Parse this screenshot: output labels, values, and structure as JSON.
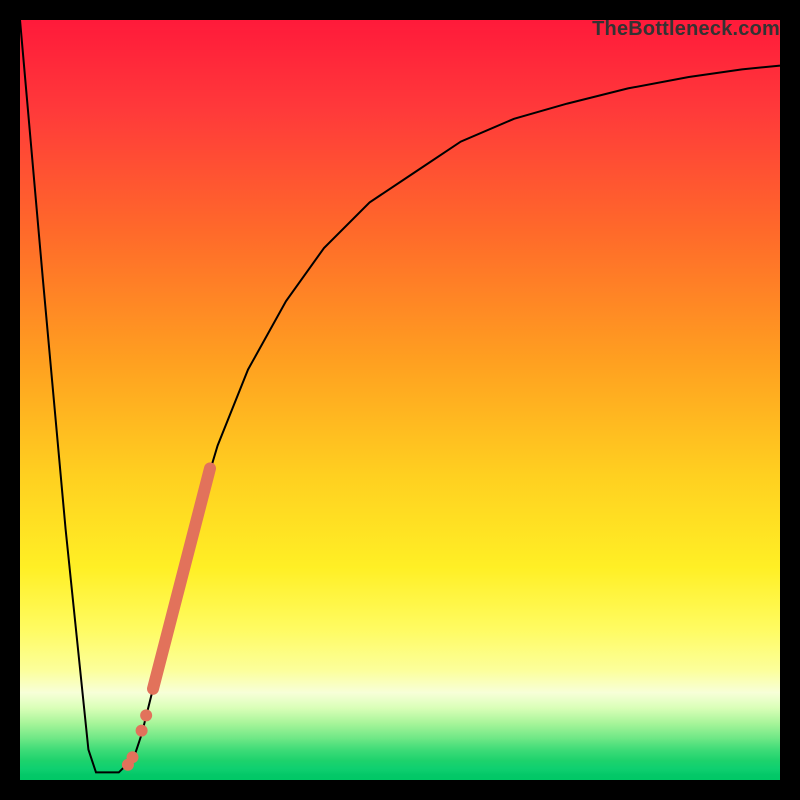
{
  "watermark": "TheBottleneck.com",
  "chart_data": {
    "type": "line",
    "title": "",
    "xlabel": "",
    "ylabel": "",
    "xlim": [
      0,
      100
    ],
    "ylim": [
      0,
      100
    ],
    "gradient": {
      "stops": [
        {
          "pct": 0,
          "color": "#ff1a3a"
        },
        {
          "pct": 12,
          "color": "#ff3a3a"
        },
        {
          "pct": 28,
          "color": "#ff6a2a"
        },
        {
          "pct": 45,
          "color": "#ffa020"
        },
        {
          "pct": 60,
          "color": "#ffd020"
        },
        {
          "pct": 72,
          "color": "#ffef25"
        },
        {
          "pct": 80,
          "color": "#fffb60"
        },
        {
          "pct": 85.5,
          "color": "#fcff9a"
        },
        {
          "pct": 88.5,
          "color": "#f7ffd8"
        },
        {
          "pct": 90.5,
          "color": "#daffb8"
        },
        {
          "pct": 92.5,
          "color": "#a8f59a"
        },
        {
          "pct": 94.5,
          "color": "#6fe886"
        },
        {
          "pct": 96,
          "color": "#3fdc78"
        },
        {
          "pct": 97.5,
          "color": "#1cd26c"
        },
        {
          "pct": 98.5,
          "color": "#0fd070"
        },
        {
          "pct": 99.3,
          "color": "#04c868"
        },
        {
          "pct": 100,
          "color": "#00c866"
        }
      ]
    },
    "series": [
      {
        "name": "bottleneck-curve",
        "x": [
          0,
          3,
          6,
          9,
          10,
          11,
          12,
          13,
          14,
          15,
          16,
          18,
          20,
          23,
          26,
          30,
          35,
          40,
          46,
          52,
          58,
          65,
          72,
          80,
          88,
          95,
          100
        ],
        "y": [
          100,
          66,
          33,
          4,
          1,
          1,
          1,
          1,
          2,
          3,
          6,
          14,
          23,
          34,
          44,
          54,
          63,
          70,
          76,
          80,
          84,
          87,
          89,
          91,
          92.5,
          93.5,
          94
        ]
      },
      {
        "name": "highlight-segment",
        "x": [
          17.5,
          25.0
        ],
        "y": [
          12.0,
          41.0
        ]
      }
    ],
    "points": [
      {
        "name": "pt1",
        "x": 14.2,
        "y": 2.0
      },
      {
        "name": "pt2",
        "x": 14.8,
        "y": 3.0
      },
      {
        "name": "pt3",
        "x": 16.0,
        "y": 6.5
      },
      {
        "name": "pt4",
        "x": 16.6,
        "y": 8.5
      }
    ]
  }
}
